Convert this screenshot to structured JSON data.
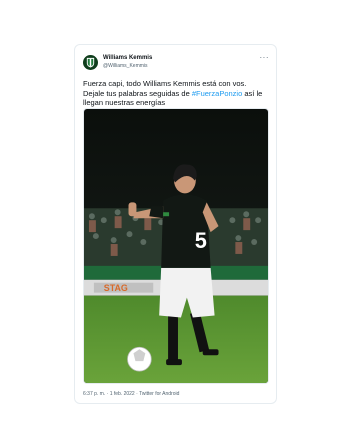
{
  "tweet": {
    "author_name": "Williams Kemmis",
    "author_handle": "@Williams_Kemmis",
    "more_icon": "ellipsis-icon",
    "text_line1": "Fuerza capi, todo Williams Kemmis está con vos.",
    "text_line2_prefix": "Dejale tus palabras seguidas de ",
    "hashtag": "#FuerzaPonzio",
    "text_line2_suffix": " así le",
    "text_line3": "llegan nuestras energías",
    "timestamp": "6:37 p. m.",
    "date": "1 feb. 2022",
    "source": "Twitter for Android",
    "separator": " · "
  },
  "media": {
    "jersey_number": "5",
    "banner_text": "STAG"
  },
  "colors": {
    "hashtag": "#1d9bf0",
    "club_green": "#0f3d1c"
  }
}
